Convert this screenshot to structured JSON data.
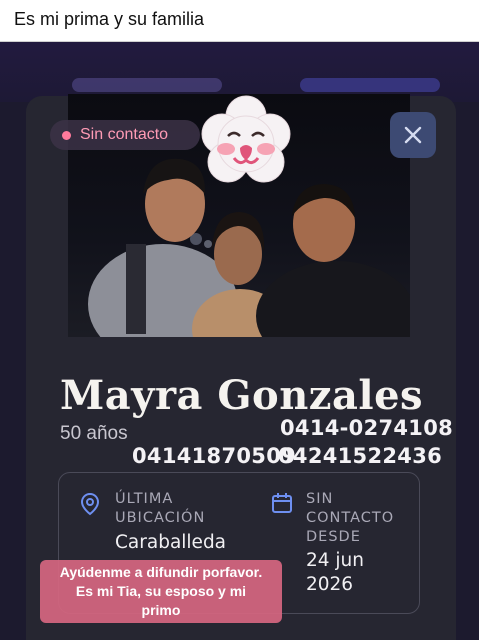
{
  "post": {
    "caption": "Es mi prima y su familia"
  },
  "card": {
    "status": "Sin contacto",
    "close_icon": "close-icon",
    "name": "Mayra Gonzales",
    "age": "50 años",
    "phones": [
      "0414-0274108",
      "04141870509",
      "04241522436"
    ],
    "last_location": {
      "icon": "location-pin-icon",
      "label_line1": "ÚLTIMA",
      "label_line2": "UBICACIÓN",
      "value": "Caraballeda"
    },
    "no_contact_since": {
      "icon": "calendar-icon",
      "label_line1": "SIN",
      "label_line2": "CONTACTO",
      "label_line3": "DESDE",
      "value_line1": "24 jun",
      "value_line2": "2026"
    }
  },
  "overlay": {
    "line1": "Ayúdenme a difundir porfavor.",
    "line2": "Es mi Tia, su esposo y mi",
    "line3": "primo"
  },
  "colors": {
    "card_bg": "#262631",
    "status_accent": "#ff7a9c",
    "overlay_bg": "#d66680"
  }
}
